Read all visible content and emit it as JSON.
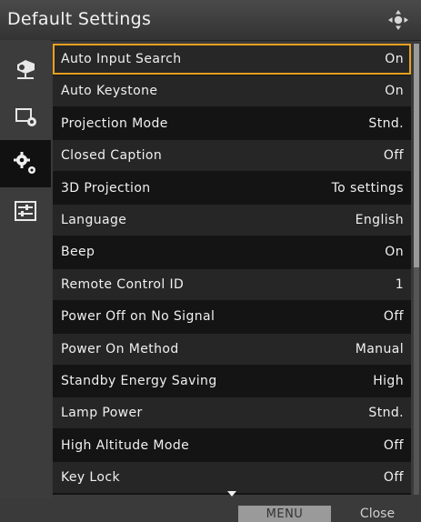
{
  "title": "Default Settings",
  "sidebar": [
    {
      "icon": "projector-icon"
    },
    {
      "icon": "display-settings-icon"
    },
    {
      "icon": "gears-icon",
      "active": true
    },
    {
      "icon": "sliders-icon"
    }
  ],
  "rows": [
    {
      "label": "Auto Input Search",
      "value": "On"
    },
    {
      "label": "Auto Keystone",
      "value": "On"
    },
    {
      "label": "Projection Mode",
      "value": "Stnd."
    },
    {
      "label": "Closed Caption",
      "value": "Off"
    },
    {
      "label": "3D Projection",
      "value": "To settings"
    },
    {
      "label": "Language",
      "value": "English"
    },
    {
      "label": "Beep",
      "value": "On"
    },
    {
      "label": "Remote Control ID",
      "value": "1"
    },
    {
      "label": "Power Off on No Signal",
      "value": "Off"
    },
    {
      "label": "Power On Method",
      "value": "Manual"
    },
    {
      "label": "Standby Energy Saving",
      "value": "High"
    },
    {
      "label": "Lamp Power",
      "value": "Stnd."
    },
    {
      "label": "High Altitude Mode",
      "value": "Off"
    },
    {
      "label": "Key Lock",
      "value": "Off"
    }
  ],
  "footer": {
    "menu_label": "MENU",
    "close_label": "Close"
  },
  "colors": {
    "selection": "#e8a020",
    "background": "#141414",
    "row_alt": "#262626"
  }
}
